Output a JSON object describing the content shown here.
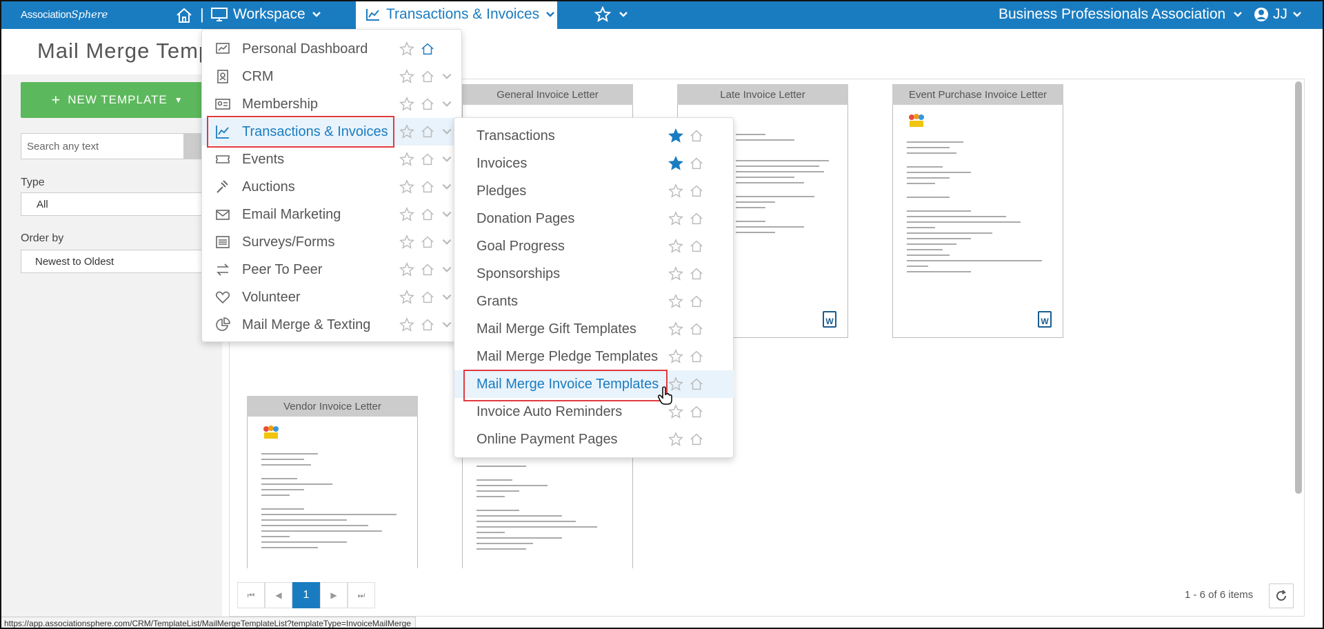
{
  "topbar": {
    "logo_main": "Association",
    "logo_sphere": "Sphere",
    "separator": "|",
    "workspace": "Workspace",
    "transactions": "Transactions & Invoices",
    "organization": "Business Professionals Association",
    "user_initials": "JJ"
  },
  "page": {
    "title": "Mail Merge Templ",
    "new_template": "NEW TEMPLATE",
    "search_placeholder": "Search any text",
    "type_label": "Type",
    "type_value": "All",
    "order_label": "Order by",
    "order_value": "Newest to Oldest"
  },
  "cards": [
    {
      "title": "General Invoice Letter"
    },
    {
      "title": "Late Invoice Letter"
    },
    {
      "title": "Event Purchase Invoice Letter"
    },
    {
      "title": "Vendor Invoice Letter"
    }
  ],
  "pager": {
    "current_page": "1",
    "info": "1 - 6 of 6 items"
  },
  "status_url": "https://app.associationsphere.com/CRM/TemplateList/MailMergeTemplateList?templateType=InvoiceMailMerge",
  "workspace_menu": [
    {
      "label": "Personal Dashboard",
      "icon": "dashboard-icon",
      "home_active": true
    },
    {
      "label": "CRM",
      "icon": "contacts-icon"
    },
    {
      "label": "Membership",
      "icon": "id-card-icon"
    },
    {
      "label": "Transactions & Invoices",
      "icon": "chart-line-icon",
      "selected": true
    },
    {
      "label": "Events",
      "icon": "ticket-icon"
    },
    {
      "label": "Auctions",
      "icon": "gavel-icon"
    },
    {
      "label": "Email Marketing",
      "icon": "envelope-icon"
    },
    {
      "label": "Surveys/Forms",
      "icon": "list-icon"
    },
    {
      "label": "Peer To Peer",
      "icon": "exchange-icon"
    },
    {
      "label": "Volunteer",
      "icon": "heart-icon"
    },
    {
      "label": "Mail Merge & Texting",
      "icon": "pie-chart-icon"
    }
  ],
  "transactions_menu": [
    {
      "label": "Transactions",
      "favorite": true
    },
    {
      "label": "Invoices",
      "favorite": true
    },
    {
      "label": "Pledges"
    },
    {
      "label": "Donation Pages"
    },
    {
      "label": "Goal Progress"
    },
    {
      "label": "Sponsorships"
    },
    {
      "label": "Grants"
    },
    {
      "label": "Mail Merge Gift Templates"
    },
    {
      "label": "Mail Merge Pledge Templates"
    },
    {
      "label": "Mail Merge Invoice Templates",
      "hovered": true
    },
    {
      "label": "Invoice Auto Reminders"
    },
    {
      "label": "Online Payment Pages"
    }
  ],
  "colors": {
    "brand_blue": "#1a7cc0",
    "new_button_green": "#5cb85c",
    "highlight_red": "#e0393e",
    "favorite_star": "#1a7cc0"
  }
}
